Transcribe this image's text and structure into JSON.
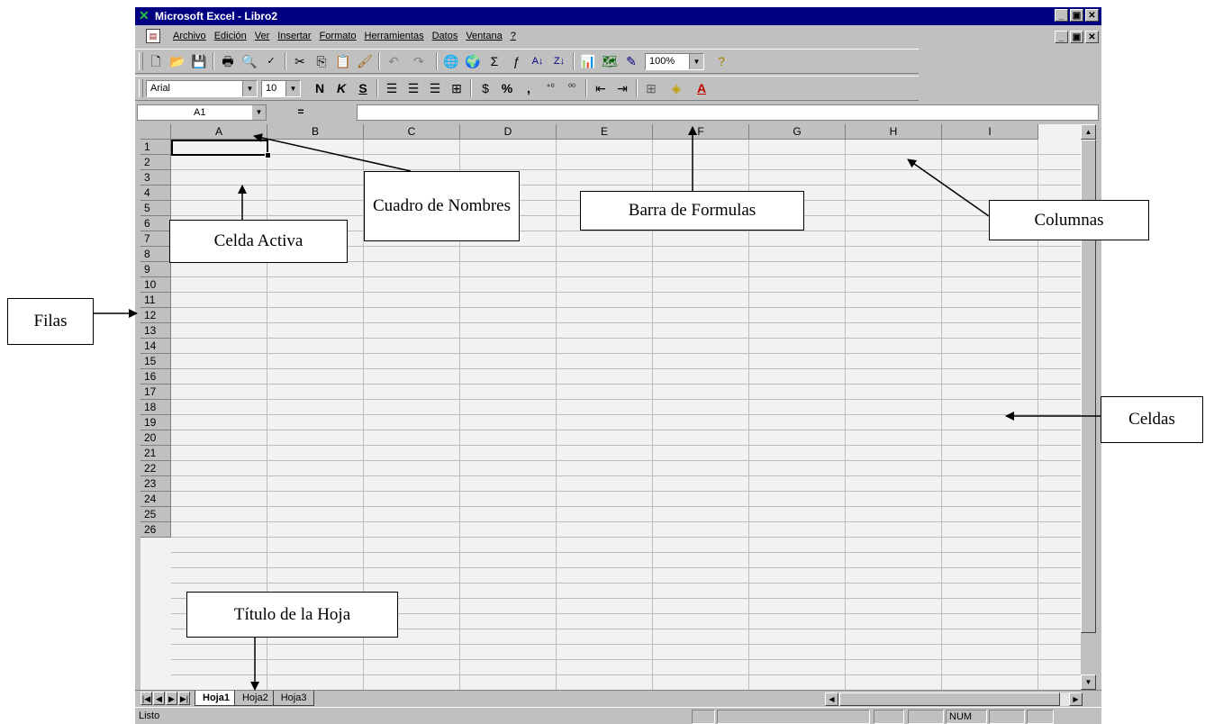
{
  "window": {
    "title": "Microsoft Excel - Libro2",
    "min": "_",
    "max": "▣",
    "close": "✕"
  },
  "menu": [
    "Archivo",
    "Edición",
    "Ver",
    "Insertar",
    "Formato",
    "Herramientas",
    "Datos",
    "Ventana",
    "?"
  ],
  "toolbar": {
    "zoom": "100%",
    "font_name": "Arial",
    "font_size": "10",
    "bold": "N",
    "italic": "K",
    "underline": "S",
    "currency": "$",
    "percent": "%",
    "thousands": ","
  },
  "formula_bar": {
    "name_box": "A1",
    "equals": "="
  },
  "columns": [
    "A",
    "B",
    "C",
    "D",
    "E",
    "F",
    "G",
    "H",
    "I"
  ],
  "rows": [
    "1",
    "2",
    "3",
    "4",
    "5",
    "6",
    "7",
    "8",
    "9",
    "10",
    "11",
    "12",
    "13",
    "14",
    "15",
    "16",
    "17",
    "18",
    "19",
    "20",
    "21",
    "22",
    "23",
    "24",
    "25",
    "26"
  ],
  "sheets": [
    "Hoja1",
    "Hoja2",
    "Hoja3"
  ],
  "active_sheet": "Hoja1",
  "status": {
    "text": "Listo",
    "num": "NUM"
  },
  "annotations": {
    "cuadro": "Cuadro de Nombres",
    "barra": "Barra de Formulas",
    "columnas": "Columnas",
    "celda": "Celda Activa",
    "filas": "Filas",
    "celdas": "Celdas",
    "titulo": "Título de la Hoja"
  },
  "colors": {
    "titlebar": "#000080",
    "chrome": "#c0c0c0",
    "grid_bg": "#f2f2f2"
  }
}
